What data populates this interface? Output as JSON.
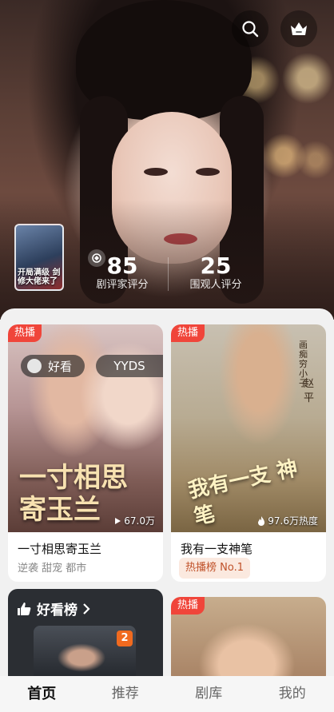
{
  "hero": {
    "critic_score": "85",
    "critic_label": "剧评家评分",
    "audience_score": "25",
    "audience_label": "围观人评分",
    "poster_text": "开局满级 剑修大佬来了"
  },
  "header_icons": {
    "search": "search-icon",
    "vip": "crown-icon"
  },
  "feed": {
    "cards": [
      {
        "tag": "热播",
        "overlay_title": "一寸相思 寄玉兰",
        "pill_left": "好看",
        "pill_right": "YYDS",
        "views": "67.0万",
        "title": "一寸相思寄玉兰",
        "subtitle": "逆袭 甜宠 都市"
      },
      {
        "tag": "热播",
        "overlay_title": "我有一支 神笔",
        "side_text_small": "画痴穷小子",
        "side_text_name": "赵平",
        "views": "97.6万热度",
        "title": "我有一支神笔",
        "rank_chip": "热播榜 No.1"
      },
      {
        "list_title": "好看榜",
        "rank_number": "2"
      },
      {
        "tag": "热播"
      }
    ]
  },
  "bottom_nav": {
    "items": [
      {
        "label": "首页",
        "active": true
      },
      {
        "label": "推荐",
        "active": false
      },
      {
        "label": "剧库",
        "active": false
      },
      {
        "label": "我的",
        "active": false
      }
    ]
  },
  "colors": {
    "hot_tag": "#f0453a",
    "rank_chip_text": "#c0522a",
    "rank_badge": "#f06a1f"
  }
}
